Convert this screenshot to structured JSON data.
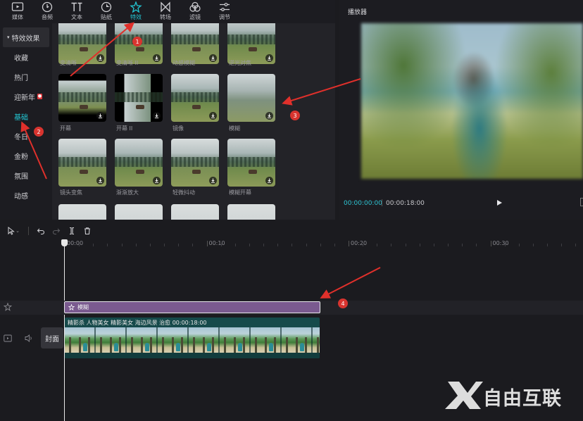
{
  "toolbar": {
    "items": [
      {
        "label": "媒体",
        "icon": "media-icon"
      },
      {
        "label": "音频",
        "icon": "audio-icon"
      },
      {
        "label": "文本",
        "icon": "text-icon"
      },
      {
        "label": "贴纸",
        "icon": "sticker-icon"
      },
      {
        "label": "特效",
        "icon": "effects-icon",
        "active": true
      },
      {
        "label": "转场",
        "icon": "transition-icon"
      },
      {
        "label": "滤镜",
        "icon": "filter-icon"
      },
      {
        "label": "调节",
        "icon": "adjust-icon"
      }
    ],
    "active_color": "#22c7d4"
  },
  "sidebar": {
    "header": "特效效果",
    "items": [
      {
        "label": "收藏"
      },
      {
        "label": "热门"
      },
      {
        "label": "迎新年",
        "badge": "new"
      },
      {
        "label": "基础",
        "active": true
      },
      {
        "label": "冬日"
      },
      {
        "label": "金粉"
      },
      {
        "label": "氛围"
      },
      {
        "label": "动感"
      }
    ]
  },
  "effects": {
    "row1": [
      "变清晰",
      "变清晰 II",
      "动感模糊",
      "逆光对焦"
    ],
    "row2": [
      "开幕",
      "开幕 II",
      "镜像",
      "模糊"
    ],
    "row3": [
      "镜头变焦",
      "渐渐放大",
      "轻微抖动",
      "模糊开幕"
    ]
  },
  "player": {
    "title": "播放器",
    "current_time": "00:00:00:00",
    "total_time": "00:00:18:00"
  },
  "timeline": {
    "ruler_labels": [
      "00:00",
      "00:10",
      "00:20",
      "00:30"
    ],
    "effect_clip_label": "模糊",
    "cover_label": "封面",
    "video_clip_info": "精影杀 人物美女 精影美女 海边风景 治愈    00:00:18:00",
    "clip_color": "#7a5a8f",
    "video_clip_color": "#164a4b"
  },
  "annotations": [
    "1",
    "2",
    "3",
    "4"
  ],
  "watermark": {
    "text": "自由互联"
  }
}
